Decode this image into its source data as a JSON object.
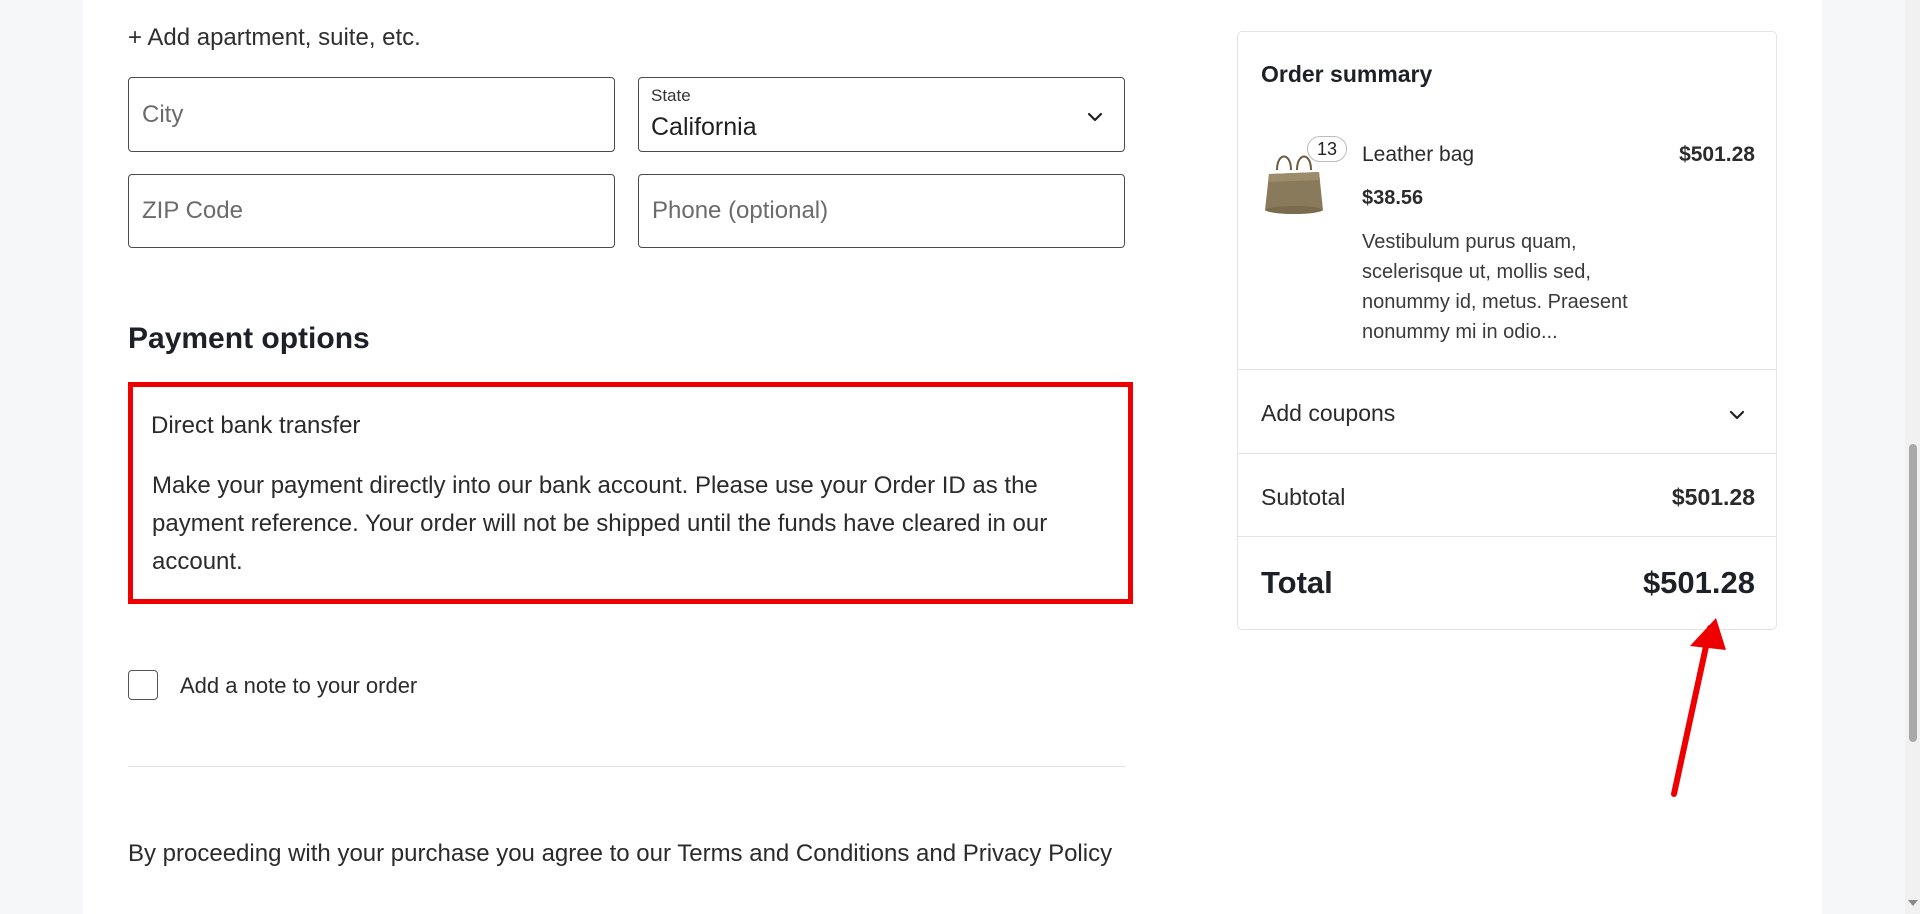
{
  "address": {
    "add_apartment_label": "+ Add apartment, suite, etc.",
    "city_placeholder": "City",
    "state_label": "State",
    "state_value": "California",
    "zip_placeholder": "ZIP Code",
    "phone_placeholder": "Phone (optional)"
  },
  "payment": {
    "heading": "Payment options",
    "method_title": "Direct bank transfer",
    "method_description": "Make your payment directly into our bank account. Please use your Order ID as the payment reference. Your order will not be shipped until the funds have cleared in our account."
  },
  "note": {
    "label": "Add a note to your order"
  },
  "terms": {
    "text": "By proceeding with your purchase you agree to our Terms and Conditions and Privacy Policy"
  },
  "summary": {
    "title": "Order summary",
    "item": {
      "quantity": "13",
      "name": "Leather bag",
      "line_total": "$501.28",
      "unit_price": "$38.56",
      "description": "Vestibulum purus quam, scelerisque ut, mollis sed, nonummy id, metus. Praesent nonummy mi in odio..."
    },
    "coupons_label": "Add coupons",
    "subtotal_label": "Subtotal",
    "subtotal_value": "$501.28",
    "total_label": "Total",
    "total_value": "$501.28"
  },
  "colors": {
    "highlight": "#ee0000",
    "annotation_arrow": "#ee0000"
  },
  "icons": {
    "state_dropdown": "chevron-down-icon",
    "coupons_toggle": "chevron-down-icon",
    "product_image": "leather-bag-icon"
  }
}
